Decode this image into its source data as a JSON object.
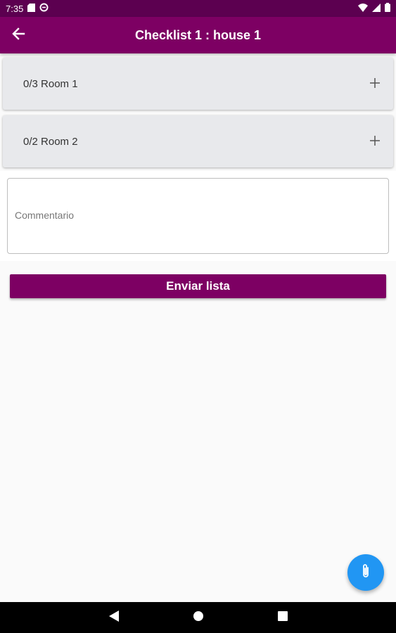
{
  "status_bar": {
    "time": "7:35",
    "icons_left": [
      "sd-card-icon",
      "sync-icon"
    ],
    "icons_right": [
      "wifi-icon",
      "signal-icon",
      "battery-icon"
    ]
  },
  "app_bar": {
    "title": "Checklist 1 : house 1",
    "back_icon": "arrow-left-icon"
  },
  "rooms": [
    {
      "label": "0/3 Room 1",
      "expand_icon": "plus-icon"
    },
    {
      "label": "0/2 Room 2",
      "expand_icon": "plus-icon"
    }
  ],
  "comment": {
    "value": "",
    "placeholder": "Commentario"
  },
  "send_button": {
    "label": "Enviar lista"
  },
  "fab": {
    "icon": "paperclip-icon"
  },
  "nav_bar": {
    "buttons": [
      "back-triangle-icon",
      "home-circle-icon",
      "recents-square-icon"
    ]
  },
  "colors": {
    "status_bar": "#5c0050",
    "primary": "#7d0063",
    "fab": "#2196f3",
    "card": "#e8e9ec"
  }
}
